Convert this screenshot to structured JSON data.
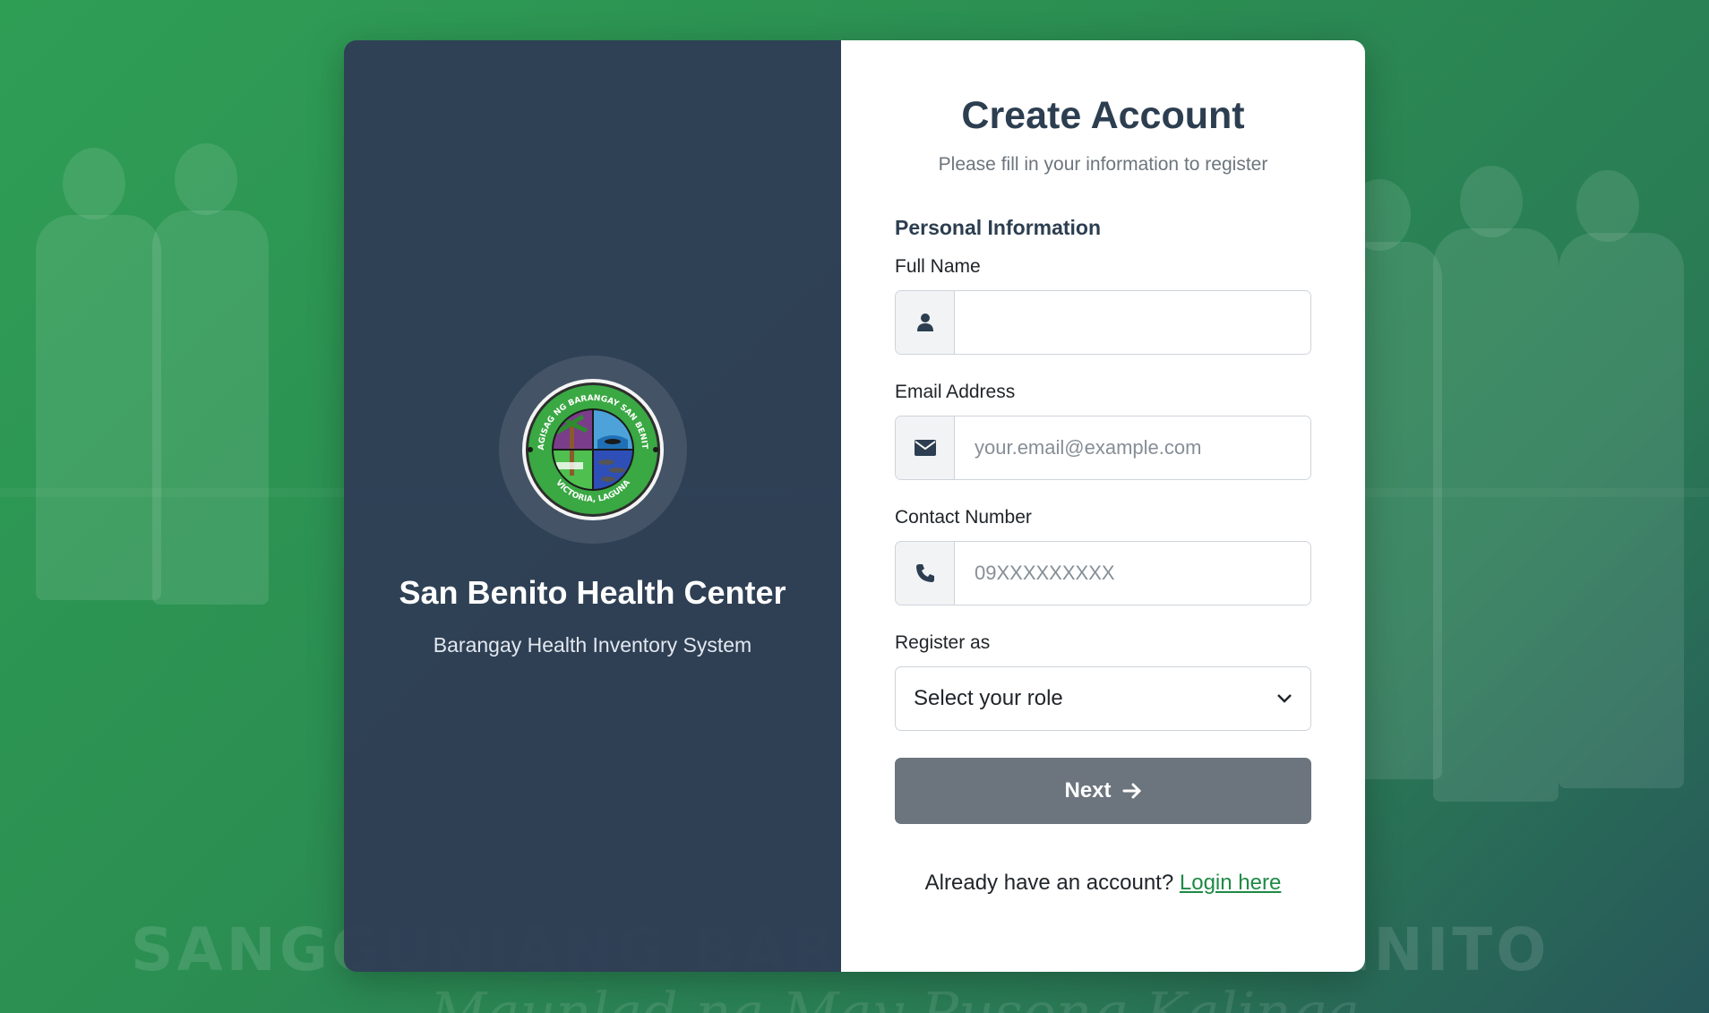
{
  "background": {
    "banner_line1": "SANGGUNIANG BARANGAY SAN BENITO",
    "banner_line2": "Maunlad na May Pusong Kalinga"
  },
  "brand": {
    "logo_name": "barangay-seal",
    "seal_top_text": "SAGISAG NG BARANGAY SAN BENITO",
    "seal_bottom_text": "VICTORIA, LAGUNA",
    "name": "San Benito Health Center",
    "tagline": "Barangay Health Inventory System"
  },
  "form": {
    "title": "Create Account",
    "subtitle": "Please fill in your information to register",
    "section_title": "Personal Information",
    "full_name": {
      "label": "Full Name",
      "value": "",
      "placeholder": "",
      "icon": "user-icon"
    },
    "email": {
      "label": "Email Address",
      "value": "",
      "placeholder": "your.email@example.com",
      "icon": "envelope-icon"
    },
    "contact": {
      "label": "Contact Number",
      "value": "",
      "placeholder": "09XXXXXXXXX",
      "icon": "phone-icon"
    },
    "role": {
      "label": "Register as",
      "selected": "Select your role"
    },
    "next_label": "Next",
    "footer_text": "Already have an account?",
    "login_link": "Login here"
  },
  "colors": {
    "accent_green": "#1e8a45",
    "panel_dark": "#2f3e56",
    "button_gray": "#6c757d"
  }
}
